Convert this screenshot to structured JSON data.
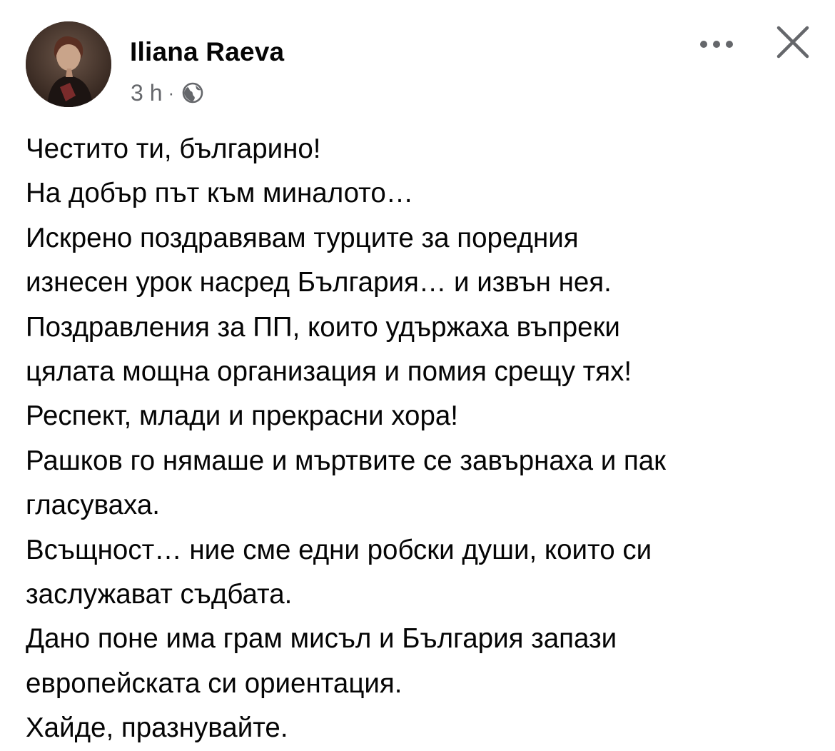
{
  "post": {
    "author": "Iliana Raeva",
    "time": "3 h",
    "separator": "·",
    "privacy_icon": "globe-icon",
    "more_icon": "more-options-icon",
    "close_icon": "close-icon",
    "lines": [
      "Честито ти, българино!",
      "На добър път към миналото…",
      "Искрено поздравявам турците за поредния",
      "изнесен урок насред България… и извън нея.",
      "Поздравления за ПП, които удържаха въпреки",
      "цялата мощна организация и помия срещу тях!",
      "Респект, млади и прекрасни хора!",
      "Рашков го нямаше и мъртвите се завърнаха и пак",
      "гласуваха.",
      "Всъщност… ние сме едни робски души, които си",
      "заслужават съдбата.",
      "Дано поне има грам мисъл и България запази",
      "европейската си ориентация.",
      "Хайде, празнувайте."
    ]
  },
  "colors": {
    "text": "#050505",
    "secondary_text": "#65676b",
    "background": "#ffffff"
  }
}
